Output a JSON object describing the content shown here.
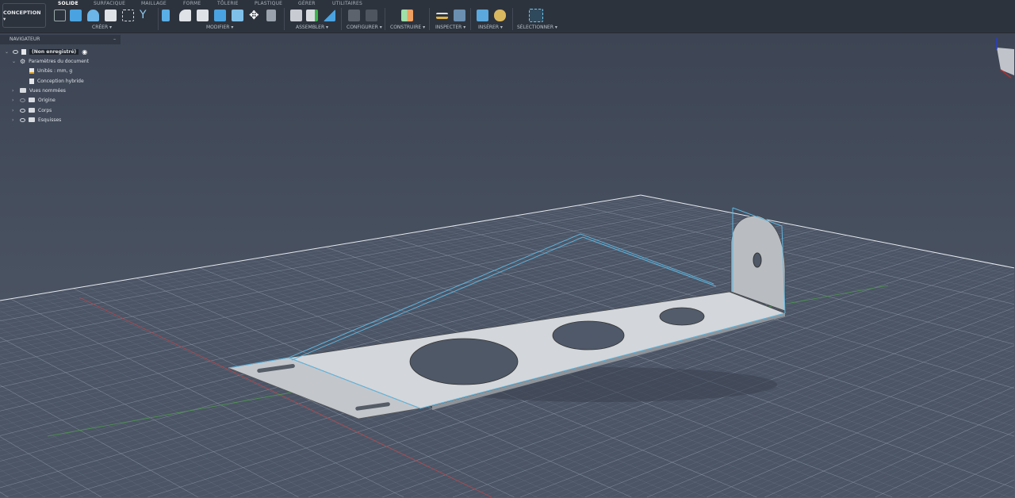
{
  "workspace": {
    "label": "CONCEPTION ▾"
  },
  "tabs": [
    "SOLIDE",
    "SURFACIQUE",
    "MAILLAGE",
    "FORME",
    "TÔLERIE",
    "PLASTIQUE",
    "GÉRER",
    "UTILITAIRES"
  ],
  "active_tab": "SOLIDE",
  "groups": [
    "CRÉER ▾",
    "MODIFIER ▾",
    "ASSEMBLER ▾",
    "CONFIGURER ▾",
    "CONSTRUIRE ▾",
    "INSPECTER ▾",
    "INSÉRER ▾",
    "SÉLECTIONNER ▾"
  ],
  "navigator": {
    "title": "NAVIGATEUR",
    "collapse": "–",
    "root": "(Non enregistré)",
    "items": [
      "Paramètres du document",
      "Unités : mm, g",
      "Conception hybride",
      "Vues nommées",
      "Origine",
      "Corps",
      "Esquisses"
    ]
  },
  "colors": {
    "accent": "#2d9cdb",
    "sketch": "#5fb4dd",
    "part": "#cdd0d4",
    "grid": "#8d98a8"
  }
}
